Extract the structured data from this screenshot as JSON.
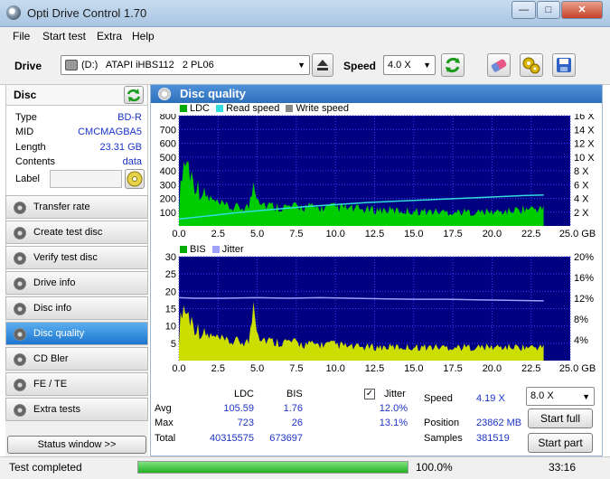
{
  "window": {
    "title": "Opti Drive Control 1.70",
    "min": "—",
    "max": "□",
    "close": "✕"
  },
  "menu": [
    "File",
    "Start test",
    "Extra",
    "Help"
  ],
  "drivebar": {
    "drive_label": "Drive",
    "drive_value": "(D:)   ATAPI iHBS112   2 PL06",
    "speed_label": "Speed",
    "speed_value": "4.0 X"
  },
  "disc": {
    "header": "Disc",
    "type_label": "Type",
    "type_value": "BD-R",
    "mid_label": "MID",
    "mid_value": "CMCMAGBA5",
    "length_label": "Length",
    "length_value": "23.31 GB",
    "contents_label": "Contents",
    "contents_value": "data",
    "label_label": "Label",
    "label_value": ""
  },
  "nav": [
    {
      "label": "Transfer rate"
    },
    {
      "label": "Create test disc"
    },
    {
      "label": "Verify test disc"
    },
    {
      "label": "Drive info"
    },
    {
      "label": "Disc info"
    },
    {
      "label": "Disc quality",
      "active": true
    },
    {
      "label": "CD Bler"
    },
    {
      "label": "FE / TE"
    },
    {
      "label": "Extra tests"
    }
  ],
  "status_window_btn": "Status window >>",
  "panel": {
    "title": "Disc quality",
    "legend_top": {
      "ldc": "LDC",
      "read": "Read speed",
      "write": "Write speed"
    },
    "legend_bottom": {
      "bis": "BIS",
      "jitter": "Jitter"
    }
  },
  "colors": {
    "plot_bg": "#000080",
    "grid": "#3c3cff",
    "ldc": "#00cc00",
    "read": "#33dddd",
    "bis": "#ccdd00",
    "jitter": "#a0a0ff",
    "accent": "#2d6fba"
  },
  "chart_data": [
    {
      "type": "area",
      "x_ticks": [
        "0.0",
        "2.5",
        "5.0",
        "7.5",
        "10.0",
        "12.5",
        "15.0",
        "17.5",
        "20.0",
        "22.5",
        "25.0 GB"
      ],
      "y_ticks_left": [
        "100",
        "200",
        "300",
        "400",
        "500",
        "600",
        "700",
        "800"
      ],
      "y_ticks_right": [
        "2 X",
        "4 X",
        "6 X",
        "8 X",
        "10 X",
        "12 X",
        "14 X",
        "16 X"
      ],
      "xlim": [
        0,
        25
      ],
      "ylim": [
        0,
        800
      ],
      "y2lim": [
        0,
        16
      ],
      "series": [
        {
          "name": "LDC",
          "x": [
            0,
            0.2,
            0.5,
            0.8,
            1,
            1.5,
            2,
            2.5,
            3,
            3.5,
            4,
            4.5,
            4.8,
            5,
            5.2,
            5.5,
            6,
            7,
            8,
            9,
            10,
            11,
            12,
            13,
            14,
            15,
            16,
            17,
            18,
            19,
            20,
            21,
            22,
            23,
            23.3
          ],
          "y": [
            120,
            560,
            620,
            470,
            410,
            300,
            250,
            200,
            180,
            165,
            175,
            180,
            440,
            300,
            250,
            200,
            185,
            175,
            180,
            165,
            175,
            160,
            150,
            150,
            140,
            140,
            135,
            130,
            130,
            130,
            130,
            135,
            160,
            160,
            160
          ]
        },
        {
          "name": "Read speed",
          "x": [
            0,
            2,
            4,
            6,
            8,
            10,
            12,
            14,
            16,
            18,
            20,
            22,
            23.3
          ],
          "y": [
            1.0,
            1.5,
            2.0,
            2.4,
            2.8,
            3.1,
            3.4,
            3.6,
            3.8,
            4.0,
            4.2,
            4.4,
            4.5
          ]
        }
      ]
    },
    {
      "type": "area",
      "x_ticks": [
        "0.0",
        "2.5",
        "5.0",
        "7.5",
        "10.0",
        "12.5",
        "15.0",
        "17.5",
        "20.0",
        "22.5",
        "25.0 GB"
      ],
      "y_ticks_left": [
        "5",
        "10",
        "15",
        "20",
        "25",
        "30"
      ],
      "y_ticks_right": [
        "4%",
        "8%",
        "12%",
        "16%",
        "20%"
      ],
      "xlim": [
        0,
        25
      ],
      "ylim": [
        0,
        30
      ],
      "y2lim": [
        0,
        20
      ],
      "series": [
        {
          "name": "BIS",
          "x": [
            0,
            0.2,
            0.5,
            0.8,
            1,
            1.5,
            2,
            2.5,
            3,
            3.5,
            4,
            4.5,
            4.8,
            5,
            5.2,
            5.5,
            6,
            7,
            8,
            9,
            10,
            11,
            12,
            13,
            14,
            15,
            16,
            17,
            18,
            19,
            20,
            21,
            22,
            23,
            23.3
          ],
          "y": [
            8,
            21,
            18,
            15,
            13,
            10,
            9,
            8,
            7,
            7,
            7,
            7,
            24,
            12,
            9,
            8,
            7,
            7,
            6,
            6,
            6,
            5,
            5,
            5,
            5,
            5,
            5,
            5,
            5,
            5,
            5,
            5,
            5,
            5,
            5
          ]
        },
        {
          "name": "Jitter",
          "x": [
            0,
            1,
            2,
            3,
            5,
            7,
            9,
            11,
            13,
            15,
            17,
            19,
            21,
            23.3
          ],
          "y": [
            12.1,
            12.0,
            12.0,
            12.0,
            12.1,
            12.0,
            12.1,
            12.0,
            11.9,
            11.8,
            11.8,
            11.7,
            11.6,
            11.5
          ]
        }
      ]
    }
  ],
  "stats": {
    "col_ldc": "LDC",
    "col_bis": "BIS",
    "jitter_label": "Jitter",
    "avg_label": "Avg",
    "avg_ldc": "105.59",
    "avg_bis": "1.76",
    "avg_jitter": "12.0%",
    "max_label": "Max",
    "max_ldc": "723",
    "max_bis": "26",
    "max_jitter": "13.1%",
    "total_label": "Total",
    "total_ldc": "40315575",
    "total_bis": "673697",
    "speed_label": "Speed",
    "speed_value": "4.19 X",
    "position_label": "Position",
    "position_value": "23862 MB",
    "samples_label": "Samples",
    "samples_value": "381519",
    "speed_select": "8.0 X",
    "start_full": "Start full",
    "start_part": "Start part"
  },
  "status": {
    "text": "Test completed",
    "progress_label": "100.0%",
    "progress": 1.0,
    "time": "33:16"
  }
}
